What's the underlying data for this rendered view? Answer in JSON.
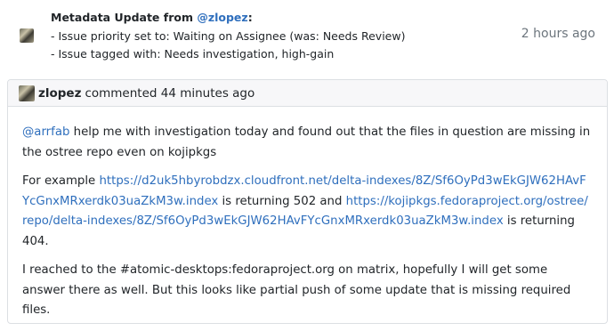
{
  "metadata_update": {
    "title_prefix": "Metadata Update from ",
    "user_link": "@zlopez",
    "title_suffix": ":",
    "line1": "- Issue priority set to: Waiting on Assignee (was: Needs Review)",
    "line2": "- Issue tagged with: Needs investigation, high-gain",
    "time": "2 hours ago"
  },
  "comment": {
    "author": "zlopez",
    "action": "commented",
    "time": "44 minutes ago",
    "p1_mention": "@arrfab",
    "p1_text": " help me with investigation today and found out that the files in question are missing in the ostree repo even on kojipkgs",
    "p2_prefix": "For example ",
    "p2_link1": "https://d2uk5hbyrobdzx.cloudfront.net/delta-indexes/8Z/Sf6OyPd3wEkGJW62HAvFYcGnxMRxerdk03uaZkM3w.index",
    "p2_mid": " is returning 502 and ",
    "p2_link2": "https://kojipkgs.fedoraproject.org/ostree/repo/delta-indexes/8Z/Sf6OyPd3wEkGJW62HAvFYcGnxMRxerdk03uaZkM3w.index",
    "p2_suffix": " is returning 404.",
    "p3_text": "I reached to the #atomic-desktops:fedoraproject.org on matrix, hopefully I will get some answer there as well. But this looks like partial push of some update that is missing required files."
  }
}
